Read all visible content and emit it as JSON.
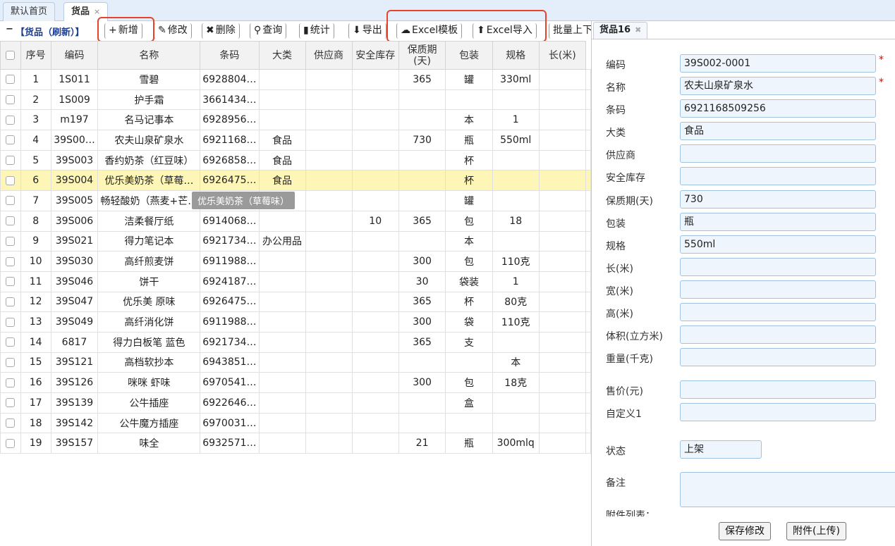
{
  "tabs": [
    {
      "label": "默认首页"
    },
    {
      "label": "货品",
      "close": "×"
    }
  ],
  "toolbar": {
    "title": "【货品（刷新）】",
    "collapse": "−",
    "buttons": [
      {
        "label": "新增",
        "icon": "+"
      },
      {
        "label": "修改",
        "icon": "✎"
      },
      {
        "label": "删除",
        "icon": "✖"
      },
      {
        "label": "查询",
        "icon": "⚲"
      },
      {
        "label": "统计",
        "icon": "▮"
      },
      {
        "label": "导出",
        "icon": "⬇"
      },
      {
        "label": "Excel模板",
        "icon": "☁"
      },
      {
        "label": "Excel导入",
        "icon": "⬆"
      },
      {
        "label": "批量上下",
        "icon": ""
      }
    ]
  },
  "grid": {
    "columns": [
      "序号",
      "编码",
      "名称",
      "条码",
      "大类",
      "供应商",
      "安全库存",
      "保质期(天)",
      "包装",
      "规格",
      "长(米)"
    ],
    "rows": [
      [
        "1",
        "1S011",
        "雪碧",
        "6928804…",
        "",
        "",
        "",
        "365",
        "罐",
        "330ml",
        ""
      ],
      [
        "2",
        "1S009",
        "护手霜",
        "3661434…",
        "",
        "",
        "",
        "",
        "",
        "",
        ""
      ],
      [
        "3",
        "m197",
        "名马记事本",
        "6928956…",
        "",
        "",
        "",
        "",
        "本",
        "1",
        ""
      ],
      [
        "4",
        "39S00…",
        "农夫山泉矿泉水",
        "6921168…",
        "食品",
        "",
        "",
        "730",
        "瓶",
        "550ml",
        ""
      ],
      [
        "5",
        "39S003",
        "香约奶茶（红豆味）",
        "6926858…",
        "食品",
        "",
        "",
        "",
        "杯",
        "",
        ""
      ],
      [
        "6",
        "39S004",
        "优乐美奶茶（草莓…",
        "6926475…",
        "食品",
        "",
        "",
        "",
        "杯",
        "",
        ""
      ],
      [
        "7",
        "39S005",
        "畅轻酸奶（燕麦+芒…",
        "",
        "",
        "",
        "",
        "",
        "罐",
        "",
        ""
      ],
      [
        "8",
        "39S006",
        "洁柔餐厅纸",
        "6914068…",
        "",
        "",
        "10",
        "365",
        "包",
        "18",
        ""
      ],
      [
        "9",
        "39S021",
        "得力笔记本",
        "6921734…",
        "办公用品",
        "",
        "",
        "",
        "本",
        "",
        ""
      ],
      [
        "10",
        "39S030",
        "高纤煎麦饼",
        "6911988…",
        "",
        "",
        "",
        "300",
        "包",
        "110克",
        ""
      ],
      [
        "11",
        "39S046",
        "饼干",
        "6924187…",
        "",
        "",
        "",
        "30",
        "袋装",
        "1",
        ""
      ],
      [
        "12",
        "39S047",
        "优乐美 原味",
        "6926475…",
        "",
        "",
        "",
        "365",
        "杯",
        "80克",
        ""
      ],
      [
        "13",
        "39S049",
        "高纤消化饼",
        "6911988…",
        "",
        "",
        "",
        "300",
        "袋",
        "110克",
        ""
      ],
      [
        "14",
        "6817",
        "得力白板笔 蓝色",
        "6921734…",
        "",
        "",
        "",
        "365",
        "支",
        "",
        ""
      ],
      [
        "15",
        "39S121",
        "高档软抄本",
        "6943851…",
        "",
        "",
        "",
        "",
        "",
        "本",
        ""
      ],
      [
        "16",
        "39S126",
        "咪咪 虾味",
        "6970541…",
        "",
        "",
        "",
        "300",
        "包",
        "18克",
        ""
      ],
      [
        "17",
        "39S139",
        "公牛插座",
        "6922646…",
        "",
        "",
        "",
        "",
        "盒",
        "",
        ""
      ],
      [
        "18",
        "39S142",
        "公牛魔方插座",
        "6970031…",
        "",
        "",
        "",
        "",
        "",
        "",
        ""
      ],
      [
        "19",
        "39S157",
        "味全",
        "6932571…",
        "",
        "",
        "",
        "21",
        "瓶",
        "300mlq",
        ""
      ]
    ],
    "selected_row": 6,
    "tooltip": "优乐美奶茶（草莓味）"
  },
  "panel": {
    "tab_label": "货品16",
    "tab_close": "✖",
    "fields": [
      {
        "label": "编码",
        "value": "39S002-0001",
        "required": "*"
      },
      {
        "label": "名称",
        "value": "农夫山泉矿泉水",
        "required": "*"
      },
      {
        "label": "条码",
        "value": "6921168509256"
      },
      {
        "label": "大类",
        "value": "食品"
      },
      {
        "label": "供应商",
        "value": ""
      },
      {
        "label": "安全库存",
        "value": ""
      },
      {
        "label": "保质期(天)",
        "value": "730"
      },
      {
        "label": "包装",
        "value": "瓶"
      },
      {
        "label": "规格",
        "value": "550ml"
      },
      {
        "label": "长(米)",
        "value": ""
      },
      {
        "label": "宽(米)",
        "value": ""
      },
      {
        "label": "高(米)",
        "value": ""
      },
      {
        "label": "体积(立方米)",
        "value": ""
      },
      {
        "label": "重量(千克)",
        "value": ""
      },
      {
        "label": "售价(元)",
        "value": ""
      },
      {
        "label": "自定义1",
        "value": ""
      },
      {
        "label": "状态",
        "value": "上架"
      },
      {
        "label": "备注",
        "value": ""
      },
      {
        "label": "附件列表：",
        "value": ""
      }
    ],
    "save_label": "保存修改",
    "attach_label": "附件(上传)"
  }
}
